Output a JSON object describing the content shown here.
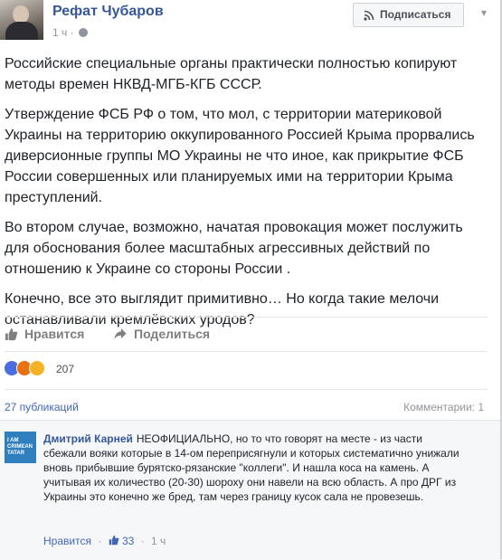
{
  "post": {
    "author": "Рефат Чубаров",
    "time": "1 ч",
    "subscribe_label": "Подписаться",
    "paragraphs": [
      "Российские специальные органы практически полностью копируют методы времен НКВД-МГБ-КГБ СССР.",
      "Утверждение ФСБ РФ о том, что мол, с территории материковой Украины на территорию оккупированного Россией Крыма прорвались диверсионные группы МО Украины не что иное, как прикрытие ФСБ России совершенных или планируемых ими на территории Крыма преступлений.",
      "Во втором случае, возможно, начатая провокация может послужить для обоснования более масштабных агрессивных действий по отношению к Украине со стороны России .",
      "Конечно, все это выглядит примитивно… Но когда такие мелочи останавливали кремлёвских уродов?"
    ]
  },
  "actions": {
    "like_label": "Нравится",
    "share_label": "Поделиться"
  },
  "reactions": {
    "count": "207",
    "types": [
      "like",
      "angry",
      "sad"
    ]
  },
  "stats": {
    "shares": "27 публикаций",
    "comments": "Комментарии: 1"
  },
  "comment": {
    "author": "Дмитрий Карней",
    "avatar_text": "I AM CRIMEAN TATAR",
    "text": "НЕОФИЦИАЛЬНО, но то что говорят на месте - из части сбежали вояки которые в 14-ом переприсягнули и которых систематично унижали вновь прибывшие бурятско-рязанские \"коллеги\". И нашла коса на камень. А учитывая их количество (20-30) шороху они навели на всю область. А про ДРГ из Украины это конечно же бред, там через границу кусок сала не провезешь.",
    "like_label": "Нравится",
    "likes": "33",
    "time": "1 ч"
  },
  "colors": {
    "link": "#365899",
    "muted": "#90949c",
    "text": "#1d2129"
  }
}
